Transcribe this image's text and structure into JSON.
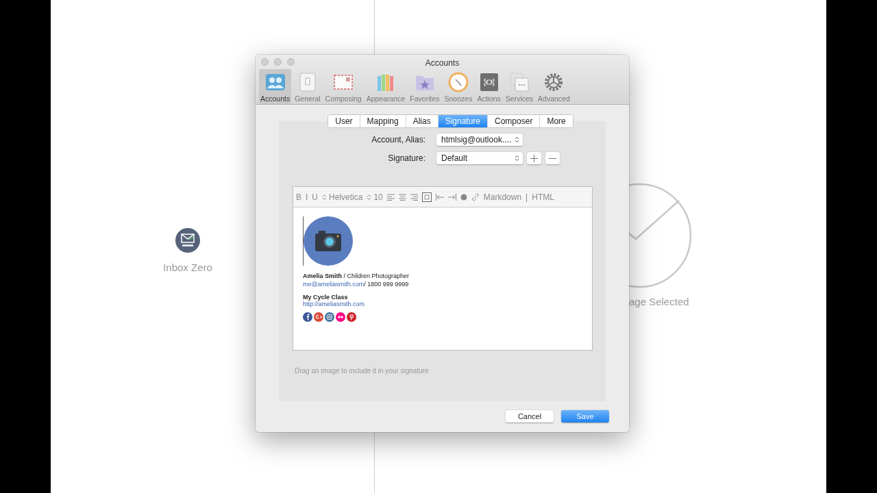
{
  "background": {
    "app_name": "Inbox Zero",
    "status_text": "age Selected"
  },
  "window": {
    "title": "Accounts"
  },
  "toolbar": [
    {
      "label": "Accounts",
      "kind": "accounts",
      "selected": true
    },
    {
      "label": "General",
      "kind": "general",
      "selected": false
    },
    {
      "label": "Composing",
      "kind": "composing",
      "selected": false
    },
    {
      "label": "Appearance",
      "kind": "appearance",
      "selected": false
    },
    {
      "label": "Favorites",
      "kind": "favorites",
      "selected": false
    },
    {
      "label": "Snoozes",
      "kind": "snoozes",
      "selected": false
    },
    {
      "label": "Actions",
      "kind": "actions",
      "selected": false
    },
    {
      "label": "Services",
      "kind": "services",
      "selected": false
    },
    {
      "label": "Advanced",
      "kind": "advanced",
      "selected": false
    }
  ],
  "tabs": [
    {
      "label": "User",
      "selected": false
    },
    {
      "label": "Mapping",
      "selected": false
    },
    {
      "label": "Alias",
      "selected": false
    },
    {
      "label": "Signature",
      "selected": true
    },
    {
      "label": "Composer",
      "selected": false
    },
    {
      "label": "More",
      "selected": false
    }
  ],
  "form": {
    "account_label": "Account, Alias:",
    "account_value": "htmlsig@outlook....",
    "signature_label": "Signature:",
    "signature_value": "Default"
  },
  "editor": {
    "toolbar": {
      "bold": "B",
      "italic": "I",
      "underline": "U",
      "font": "Helvetica",
      "size": "10",
      "markdown": "Markdown",
      "separator": "|",
      "html": "HTML"
    },
    "signature": {
      "name_line": "**Amelia Smith** / Children Photographer",
      "email": "me@ameliasmith.com",
      "phone": " / 1800 999 9999",
      "company": "My Cycle Class",
      "website": "http://ameliasmith.com",
      "social": [
        {
          "kind": "facebook",
          "color": "#3b5998"
        },
        {
          "kind": "googleplus",
          "color": "#dd4b39"
        },
        {
          "kind": "instagram",
          "color": "#3f729b"
        },
        {
          "kind": "flickr",
          "color": "#ff0084"
        },
        {
          "kind": "pinterest",
          "color": "#cb2027"
        }
      ]
    }
  },
  "hint": "Drag an image to include it in your signature",
  "buttons": [
    {
      "label": "Cancel",
      "kind": "secondary"
    },
    {
      "label": "Save",
      "kind": "primary"
    }
  ]
}
